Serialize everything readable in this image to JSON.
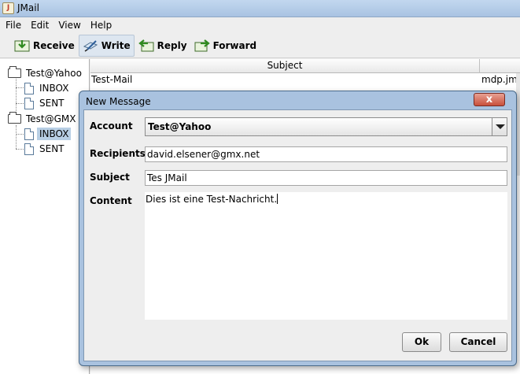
{
  "window": {
    "title": "JMail",
    "icon": "java-app-icon"
  },
  "menu": [
    "File",
    "Edit",
    "View",
    "Help"
  ],
  "toolbar": {
    "receive": "Receive",
    "write": "Write",
    "reply": "Reply",
    "forward": "Forward"
  },
  "tree": {
    "accounts": [
      {
        "name": "Test@Yahoo",
        "folders": [
          "INBOX",
          "SENT"
        ]
      },
      {
        "name": "Test@GMX",
        "folders": [
          "INBOX",
          "SENT"
        ]
      }
    ],
    "selected": "Test@GMX/INBOX"
  },
  "table": {
    "columns": [
      "Subject"
    ],
    "rows": [
      {
        "subject": "Test-Mail",
        "from": "mdp.jma"
      }
    ]
  },
  "dialog": {
    "title": "New Message",
    "close_label": "x",
    "account_label": "Account",
    "account_value": "Test@Yahoo",
    "recipients_label": "Recipients",
    "recipients_value": "david.elsener@gmx.net",
    "subject_label": "Subject",
    "subject_value": "Tes JMail",
    "content_label": "Content",
    "content_value": "Dies ist eine Test-Nachricht.",
    "ok_label": "Ok",
    "cancel_label": "Cancel"
  },
  "colors": {
    "title_bar": "#b3cbe8",
    "selection": "#b8cfe5",
    "close_button": "#c8503c"
  }
}
